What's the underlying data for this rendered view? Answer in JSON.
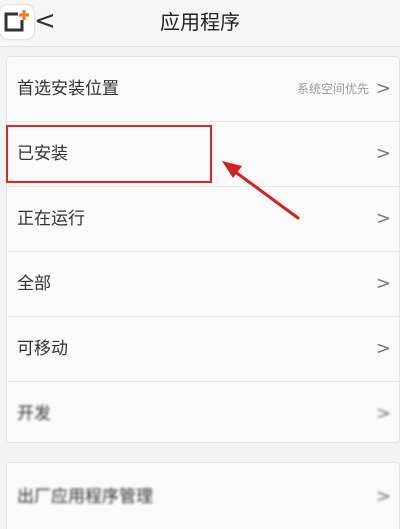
{
  "header": {
    "title": "应用程序",
    "back_glyph": "<"
  },
  "settings": {
    "items": [
      {
        "label": "首选安装位置",
        "value": "系统空间优先",
        "chevron": ">"
      },
      {
        "label": "已安装",
        "chevron": ">"
      },
      {
        "label": "正在运行",
        "chevron": ">"
      },
      {
        "label": "全部",
        "chevron": ">"
      },
      {
        "label": "可移动",
        "chevron": ">"
      },
      {
        "label": "开发",
        "chevron": ">"
      }
    ],
    "extra": {
      "label": "出厂应用程序管理",
      "chevron": ">"
    }
  },
  "annotation": {
    "highlight_color": "#e02424",
    "highlighted_item": "已安装"
  }
}
